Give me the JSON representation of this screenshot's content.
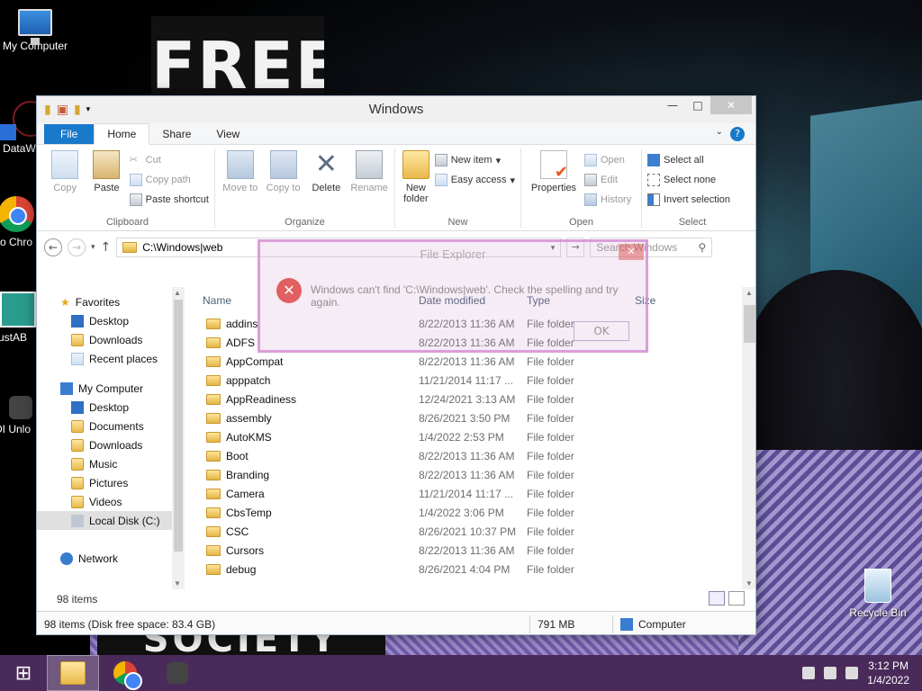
{
  "desktop": {
    "wallpaper_text_top": "FREE",
    "wallpaper_text_bottom": "SOCIETY",
    "icons": [
      {
        "label": "My Computer"
      },
      {
        "label": "DataWa"
      },
      {
        "label": "Goo Chro"
      },
      {
        "label": "JustAB"
      },
      {
        "label": "IOI Unlo"
      },
      {
        "label": "Recycle Bin"
      }
    ]
  },
  "window": {
    "title": "Windows",
    "tabs": [
      "File",
      "Home",
      "Share",
      "View"
    ],
    "ribbon": {
      "clipboard": {
        "label": "Clipboard",
        "copy": "Copy",
        "paste": "Paste",
        "cut": "Cut",
        "copy_path": "Copy path",
        "paste_shortcut": "Paste shortcut"
      },
      "organize": {
        "label": "Organize",
        "move_to": "Move to",
        "copy_to": "Copy to",
        "delete": "Delete",
        "rename": "Rename"
      },
      "new": {
        "label": "New",
        "new_folder": "New folder",
        "new_item": "New item",
        "easy_access": "Easy access"
      },
      "open": {
        "label": "Open",
        "properties": "Properties",
        "open": "Open",
        "edit": "Edit",
        "history": "History"
      },
      "select": {
        "label": "Select",
        "select_all": "Select all",
        "select_none": "Select none",
        "invert_selection": "Invert selection"
      }
    },
    "address": "C:\\Windows|web",
    "search_placeholder": "Search Windows",
    "nav": {
      "favorites": "Favorites",
      "fav_items": [
        "Desktop",
        "Downloads",
        "Recent places"
      ],
      "computer": "My Computer",
      "computer_items": [
        "Desktop",
        "Documents",
        "Downloads",
        "Music",
        "Pictures",
        "Videos",
        "Local Disk (C:)"
      ],
      "network": "Network"
    },
    "columns": {
      "name": "Name",
      "date": "Date modified",
      "type": "Type",
      "size": "Size"
    },
    "rows": [
      {
        "name": "addins",
        "date": "8/22/2013 11:36 AM",
        "type": "File folder"
      },
      {
        "name": "ADFS",
        "date": "8/22/2013 11:36 AM",
        "type": "File folder"
      },
      {
        "name": "AppCompat",
        "date": "8/22/2013 11:36 AM",
        "type": "File folder"
      },
      {
        "name": "apppatch",
        "date": "11/21/2014 11:17 ...",
        "type": "File folder"
      },
      {
        "name": "AppReadiness",
        "date": "12/24/2021 3:13 AM",
        "type": "File folder"
      },
      {
        "name": "assembly",
        "date": "8/26/2021 3:50 PM",
        "type": "File folder"
      },
      {
        "name": "AutoKMS",
        "date": "1/4/2022 2:53 PM",
        "type": "File folder"
      },
      {
        "name": "Boot",
        "date": "8/22/2013 11:36 AM",
        "type": "File folder"
      },
      {
        "name": "Branding",
        "date": "8/22/2013 11:36 AM",
        "type": "File folder"
      },
      {
        "name": "Camera",
        "date": "11/21/2014 11:17 ...",
        "type": "File folder"
      },
      {
        "name": "CbsTemp",
        "date": "1/4/2022 3:06 PM",
        "type": "File folder"
      },
      {
        "name": "CSC",
        "date": "8/26/2021 10:37 PM",
        "type": "File folder"
      },
      {
        "name": "Cursors",
        "date": "8/22/2013 11:36 AM",
        "type": "File folder"
      },
      {
        "name": "debug",
        "date": "8/26/2021 4:04 PM",
        "type": "File folder"
      }
    ],
    "item_count": "98 items",
    "status_info": "98 items (Disk free space: 83.4 GB)",
    "status_size": "791 MB",
    "status_location": "Computer"
  },
  "dialog": {
    "title": "File Explorer",
    "message": "Windows can't find 'C:\\Windows|web'. Check the spelling and try again.",
    "ok": "OK"
  },
  "taskbar": {
    "time": "3:12 PM",
    "date": "1/4/2022"
  },
  "colors": {
    "accent": "#1979ca",
    "taskbar": "#4a2a5a"
  }
}
